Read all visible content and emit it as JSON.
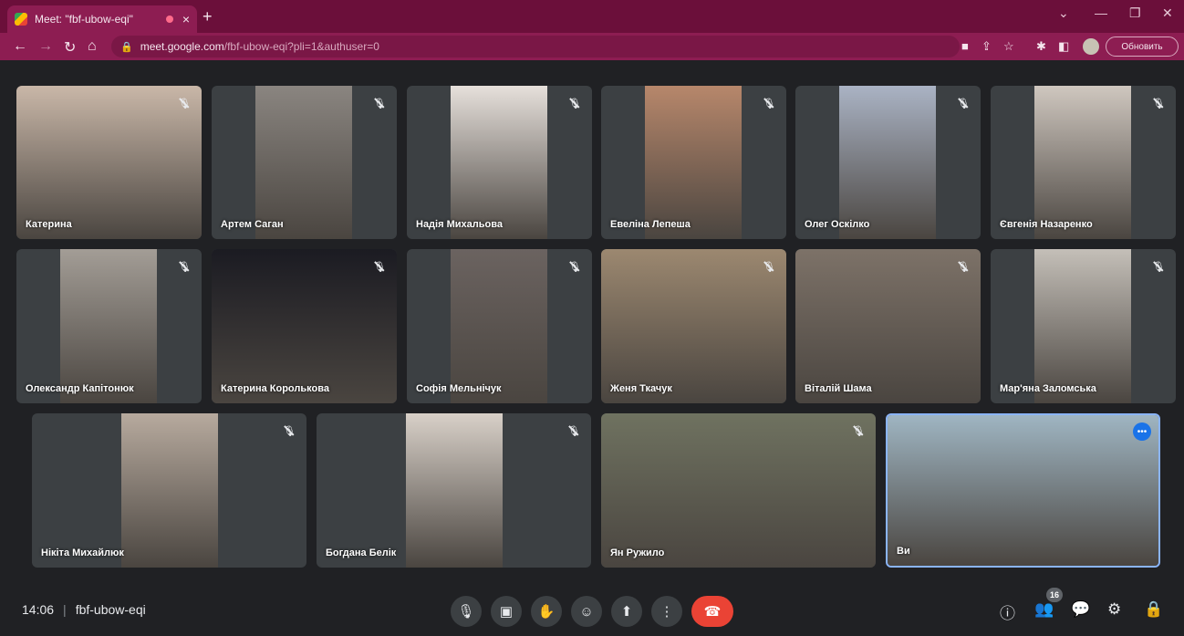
{
  "browser": {
    "tab_title": "Meet: \"fbf-ubow-eqi\"",
    "tab_close": "×",
    "new_tab": "+",
    "url_host": "meet.google.com",
    "url_path": "/fbf-ubow-eqi?pli=1&authuser=0",
    "update_button": "Обновить"
  },
  "participants": [
    {
      "name": "Катерина",
      "muted": true,
      "color": "#c9b7a8"
    },
    {
      "name": "Артем Саган",
      "muted": true,
      "color": "#8a8580"
    },
    {
      "name": "Надія Михальова",
      "muted": true,
      "color": "#e6e0db"
    },
    {
      "name": "Евеліна Лепеша",
      "muted": true,
      "color": "#b7876b"
    },
    {
      "name": "Олег Оскілко",
      "muted": true,
      "color": "#aab3c4"
    },
    {
      "name": "Євгенія Назаренко",
      "muted": true,
      "color": "#cfc7bf"
    },
    {
      "name": "Олександр Капітонюк",
      "muted": true,
      "color": "#a39d96"
    },
    {
      "name": "Катерина Королькова",
      "muted": true,
      "color": "#1b1b22"
    },
    {
      "name": "Софія Мельнічук",
      "muted": true,
      "color": "#6b6360"
    },
    {
      "name": "Женя Ткачук",
      "muted": true,
      "color": "#9c8870"
    },
    {
      "name": "Віталій Шама",
      "muted": true,
      "color": "#7d7268"
    },
    {
      "name": "Мар'яна Заломська",
      "muted": true,
      "color": "#c4bfb8"
    },
    {
      "name": "Нікіта Михайлюк",
      "muted": true,
      "color": "#b7aa9e"
    },
    {
      "name": "Богдана Белік",
      "muted": true,
      "color": "#d8d0c8"
    },
    {
      "name": "Ян Ружило",
      "muted": true,
      "color": "#6f7260"
    },
    {
      "name": "Ви",
      "muted": false,
      "color": "#9fb5c2"
    }
  ],
  "bottom_bar": {
    "time": "14:06",
    "separator": "|",
    "meeting_code": "fbf-ubow-eqi",
    "participant_count": "16"
  },
  "icons": {
    "mic": "🎙",
    "camera": "▣",
    "raise_hand": "✋",
    "emoji": "☺",
    "present": "⬆",
    "more": "⋮",
    "end_call": "☎",
    "info": "ⓘ",
    "people": "👥",
    "chat": "💬",
    "activities": "⚙",
    "host_controls": "🔒",
    "tile_more": "•••"
  },
  "theme": {
    "browser_accent": "#8d1d52",
    "meet_background": "#202124",
    "end_call_red": "#ea4335",
    "active_speaker_blue": "#8ab4f8"
  }
}
